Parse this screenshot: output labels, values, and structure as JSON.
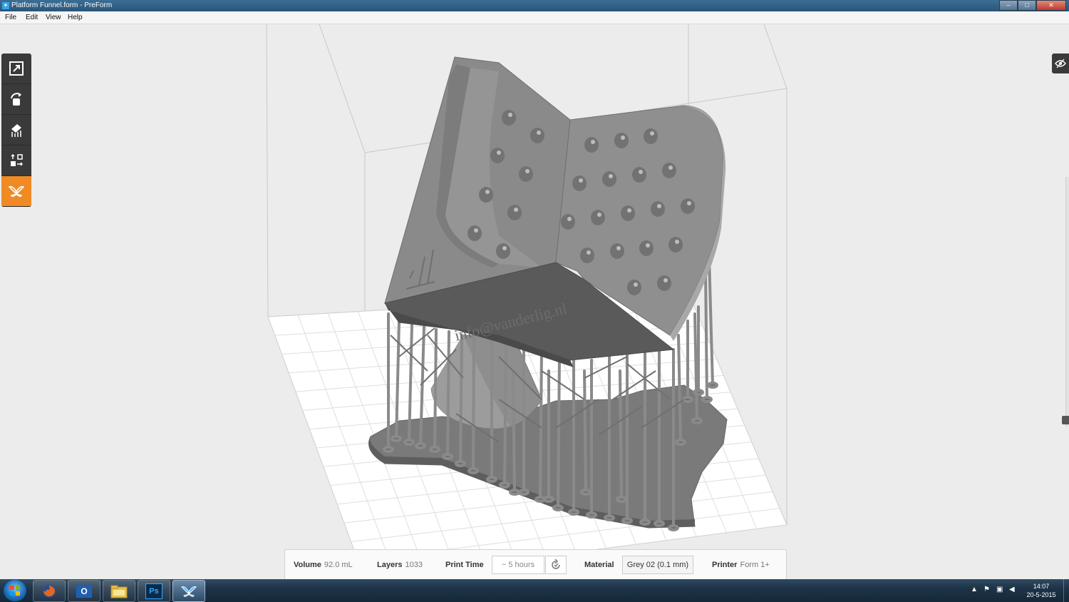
{
  "window": {
    "title": "Platform Funnel.form - PreForm",
    "app_icon": "preform-butterfly-icon",
    "minimize": "–",
    "maximize": "□",
    "close": "✕"
  },
  "menu": {
    "items": [
      {
        "label": "File"
      },
      {
        "label": "Edit"
      },
      {
        "label": "View"
      },
      {
        "label": "Help"
      }
    ]
  },
  "toolbar": {
    "tools": [
      {
        "name": "scale-icon"
      },
      {
        "name": "rotate-icon"
      },
      {
        "name": "supports-icon"
      },
      {
        "name": "layout-icon"
      },
      {
        "name": "print-butterfly-icon",
        "active": true
      }
    ]
  },
  "model": {
    "engraving": "info@vanderlig.nl",
    "accent_color": "#f08a24",
    "model_color": "#8a8a8a"
  },
  "info": {
    "volume_label": "Volume",
    "volume_value": "92.0 mL",
    "layers_label": "Layers",
    "layers_value": "1033",
    "print_time_label": "Print Time",
    "print_time_value": "~ 5 hours",
    "material_label": "Material",
    "material_value": "Grey 02 (0.1 mm)",
    "printer_label": "Printer",
    "printer_value": "Form 1+"
  },
  "taskbar": {
    "apps": [
      {
        "name": "firefox-icon"
      },
      {
        "name": "outlook-icon",
        "label": "O"
      },
      {
        "name": "file-explorer-icon"
      },
      {
        "name": "photoshop-icon",
        "label": "Ps"
      },
      {
        "name": "preform-icon",
        "active": true
      }
    ],
    "clock_time": "14:07",
    "clock_date": "20-5-2015"
  }
}
